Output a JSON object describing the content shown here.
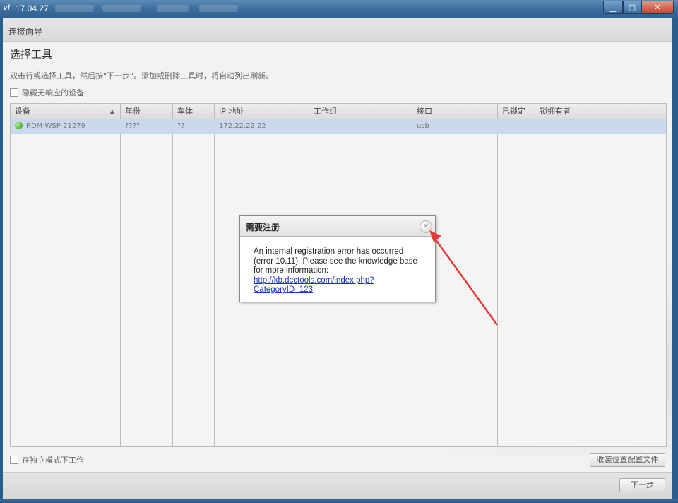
{
  "window": {
    "title": "17.04.27",
    "app_icon_glyph": "vi",
    "minimize_glyph": "▁",
    "maximize_glyph": "□",
    "close_glyph": "✕"
  },
  "wizard": {
    "header": "连接向导",
    "page_title": "选择工具",
    "instructions": "双击行或选择工具，然后按\"下一步\"。添加或删除工具时，将自动列出刷新。",
    "hide_unresponsive_label": "隐藏无响应的设备",
    "standalone_mode_label": "在独立模式下工作",
    "install_config_button": "收装位置配置文件",
    "next_button": "下一步"
  },
  "table": {
    "columns": [
      "设备",
      "年份",
      "车体",
      "IP 地址",
      "工作组",
      "接口",
      "已锁定",
      "锁拥有者"
    ],
    "sort_indicator": "▲",
    "rows": [
      {
        "device": "RDM-WSP-21279",
        "year": "????",
        "body": "??",
        "ip": "172.22.22.22",
        "workgroup": "",
        "interface": "usb",
        "locked": "",
        "lock_owner": ""
      }
    ]
  },
  "dialog": {
    "title": "需要注册",
    "close_glyph": "✕",
    "message_lines": [
      "An internal registration error has occurred",
      "(error 10.11). Please see the knowledge base",
      "for more information:"
    ],
    "link_lines": [
      "http://kb.dcctools.com/index.php?",
      "CategoryID=123"
    ]
  },
  "colors": {
    "selected_row": "#c9d8ea",
    "link": "#1a33c7",
    "annotation_arrow": "#e53935",
    "status_online": "#4caf3a"
  }
}
